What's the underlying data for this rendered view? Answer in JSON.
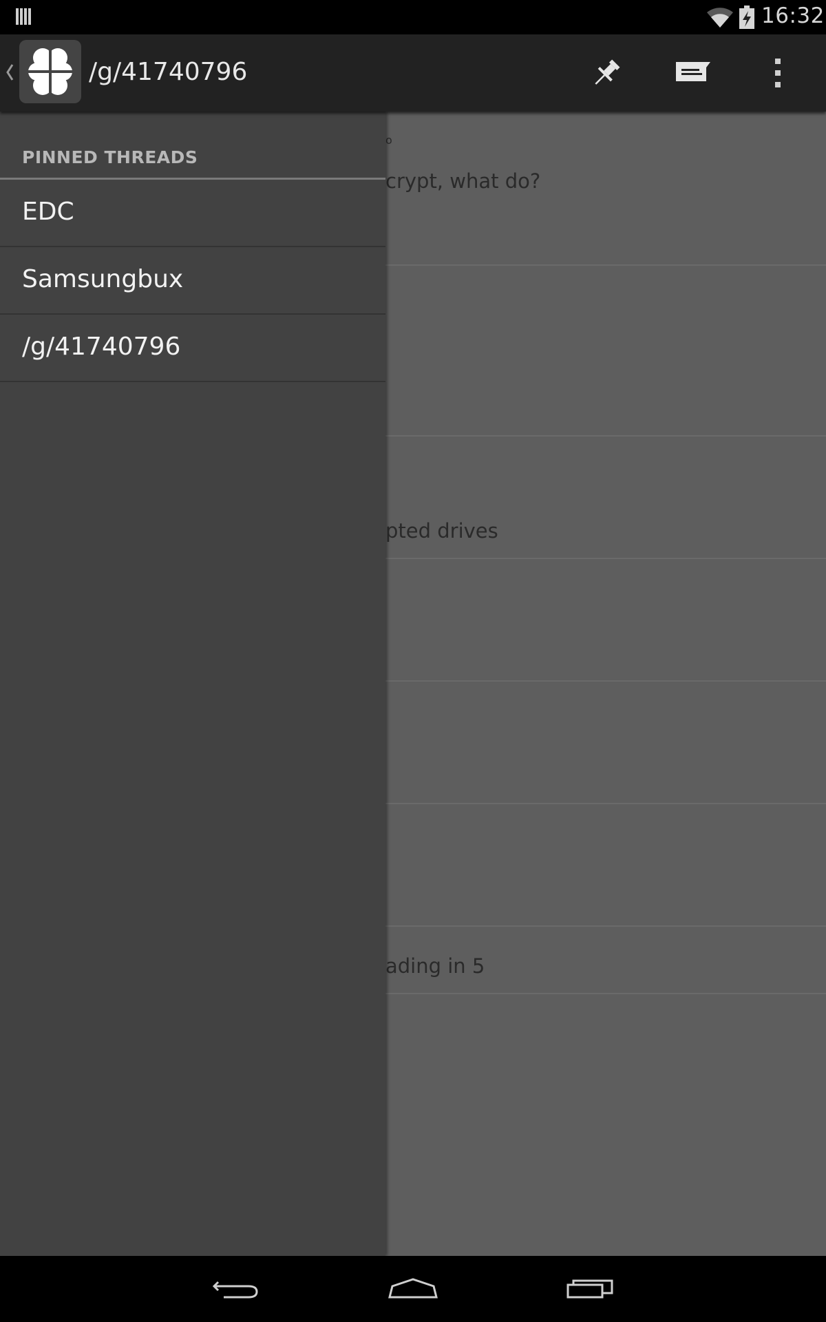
{
  "status_bar": {
    "time": "16:32",
    "icons": [
      "notification-icon",
      "wifi-icon",
      "battery-charging-icon"
    ]
  },
  "action_bar": {
    "title": "/g/41740796",
    "icons": [
      "up-caret-icon",
      "four-leaf-clover-icon",
      "pin-icon",
      "reply-icon",
      "overflow-menu-icon"
    ]
  },
  "drawer": {
    "header": "PINNED THREADS",
    "items": [
      {
        "label": "EDC"
      },
      {
        "label": "Samsungbux"
      },
      {
        "label": "/g/41740796"
      }
    ]
  },
  "content": {
    "snippets": [
      "o",
      "crypt, what do?",
      "pted drives",
      "ading in 5"
    ]
  },
  "nav_bar": {
    "icons": [
      "back-icon",
      "home-icon",
      "recents-icon"
    ]
  },
  "colors": {
    "status_bar": "#000000",
    "action_bar": "#222222",
    "drawer": "#424242",
    "content_dimmed": "#5e5e5e"
  }
}
